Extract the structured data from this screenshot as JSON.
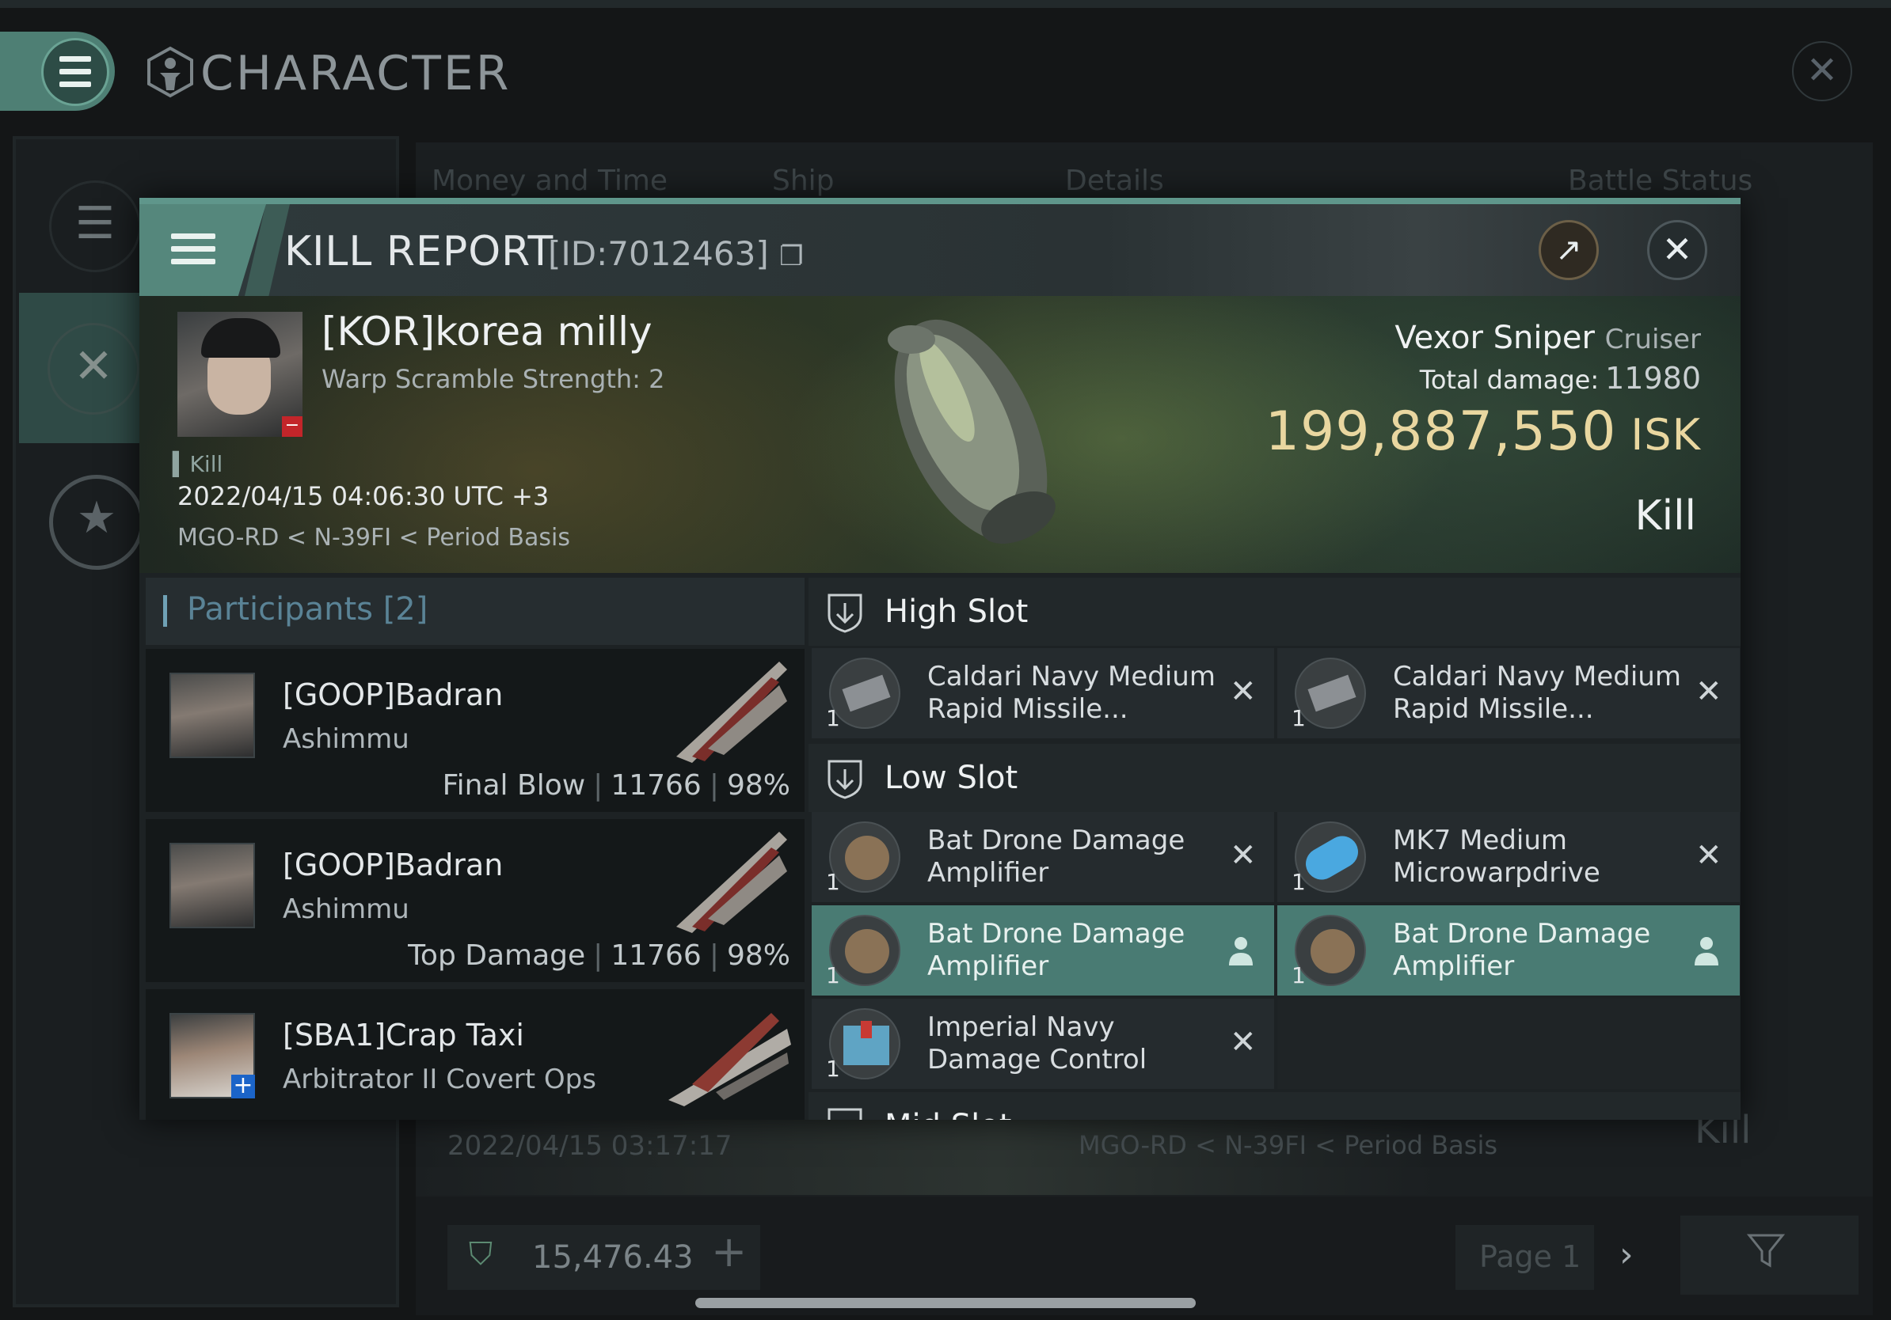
{
  "app": {
    "title": "CHARACTER",
    "tabs": [
      "Money and Time",
      "Ship",
      "Details",
      "Battle Status"
    ],
    "bg_row": {
      "date": "2022/04/15 03:17:17",
      "location": "MGO-RD < N-39FI < Period Basis",
      "status": "Kill"
    },
    "footer": {
      "isk_value": "15,476.43",
      "page_label": "Page 1"
    }
  },
  "dialog": {
    "title": "KILL REPORT",
    "id_label": "[ID:7012463]",
    "victim": {
      "name": "[KOR]korea milly",
      "subtitle": "Warp Scramble Strength: 2",
      "tag": "Kill",
      "datetime": "2022/04/15 04:06:30 UTC +3",
      "location": "MGO-RD < N-39FI < Period Basis"
    },
    "ship": {
      "name": "Vexor Sniper",
      "class": "Cruiser",
      "total_damage_label": "Total damage:",
      "total_damage": "11980",
      "isk_value": "199,887,550",
      "isk_unit": "ISK",
      "result": "Kill"
    },
    "participants": {
      "title": "Participants",
      "count": "[2]",
      "rows": [
        {
          "name": "[GOOP]Badran",
          "ship": "Ashimmu",
          "role": "Final Blow",
          "damage": "11766",
          "percent": "98%"
        },
        {
          "name": "[GOOP]Badran",
          "ship": "Ashimmu",
          "role": "Top Damage",
          "damage": "11766",
          "percent": "98%"
        },
        {
          "name": "[SBA1]Crap Taxi",
          "ship": "Arbitrator II Covert Ops"
        }
      ]
    },
    "slots": {
      "high": {
        "title": "High Slot",
        "modules": [
          {
            "qty": "1",
            "name": "Caldari Navy Medium Rapid Missile...",
            "state": "destroyed"
          },
          {
            "qty": "1",
            "name": "Caldari Navy Medium Rapid Missile...",
            "state": "destroyed"
          }
        ]
      },
      "low": {
        "title": "Low Slot",
        "modules": [
          {
            "qty": "1",
            "name": "Bat Drone Damage Amplifier",
            "state": "destroyed"
          },
          {
            "qty": "1",
            "name": "MK7 Medium Microwarpdrive",
            "state": "destroyed"
          },
          {
            "qty": "1",
            "name": "Bat Drone Damage Amplifier",
            "state": "dropped"
          },
          {
            "qty": "1",
            "name": "Bat Drone Damage Amplifier",
            "state": "dropped"
          },
          {
            "qty": "1",
            "name": "Imperial Navy Damage Control",
            "state": "destroyed"
          }
        ]
      },
      "mid": {
        "title": "Mid Slot"
      }
    }
  },
  "colors": {
    "accent": "#5f968b",
    "isk_gold": "#e9d7a0",
    "selected_row": "#497b73",
    "participants_title": "#5a8396"
  },
  "icons": {
    "close": "close-icon",
    "share": "external-link-icon",
    "menu": "hamburger-icon",
    "destroyed": "x-icon",
    "dropped": "person-icon"
  }
}
